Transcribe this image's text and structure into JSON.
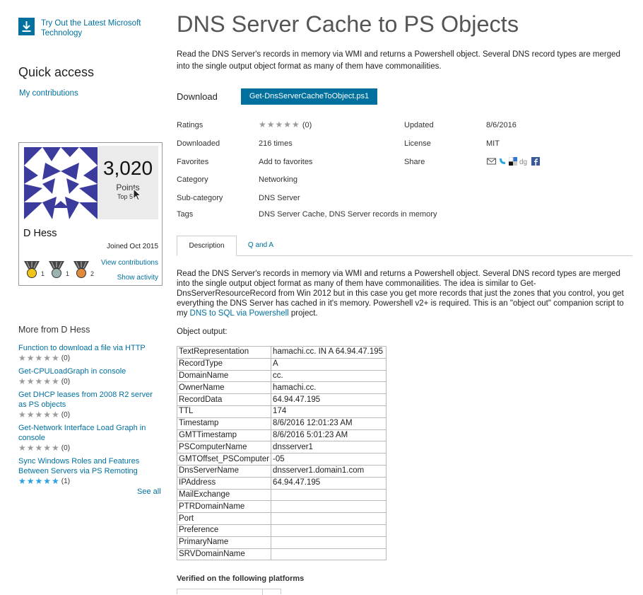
{
  "sidebar": {
    "promo_text": "Try Out the Latest Microsoft Technology",
    "quick_access_title": "Quick access",
    "my_contributions": "My contributions",
    "profile": {
      "points": "3,020",
      "points_label": "Points",
      "rank": "Top 5%",
      "name": "D Hess",
      "joined": "Joined Oct 2015",
      "view_contributions": "View contributions",
      "show_activity": "Show activity",
      "medals": [
        {
          "color": "#f0c419",
          "count": "1"
        },
        {
          "color": "#9bb3b0",
          "count": "1"
        },
        {
          "color": "#e08a3c",
          "count": "2"
        }
      ]
    },
    "more_title": "More from D Hess",
    "more_items": [
      {
        "title": "Function to download a file via HTTP",
        "stars": "★★★★★",
        "rating": "(0)",
        "star_color": "grey"
      },
      {
        "title": "Get-CPULoadGraph in console",
        "stars": "★★★★★",
        "rating": "(0)",
        "star_color": "grey"
      },
      {
        "title": "Get DHCP leases from 2008 R2 server as PS objects",
        "stars": "★★★★★",
        "rating": "(0)",
        "star_color": "grey"
      },
      {
        "title": "Get-Network Interface Load Graph in console",
        "stars": "★★★★★",
        "rating": "(0)",
        "star_color": "grey"
      },
      {
        "title": "Sync Windows Roles and Features Between Servers via PS Remoting",
        "stars": "★★★★★",
        "rating": "(1)",
        "star_color": "blue"
      }
    ],
    "see_all": "See all"
  },
  "main": {
    "title": "DNS Server Cache to PS Objects",
    "summary": "Read the DNS Server's records in memory via WMI and returns a Powershell object. Several DNS record types are merged into the single output object format as many of them have commonailities.",
    "download_label": "Download",
    "download_file": "Get-DnsServerCacheToObject.ps1",
    "meta": {
      "ratings_label": "Ratings",
      "ratings_stars": "★★★★★",
      "ratings_count": "(0)",
      "updated_label": "Updated",
      "updated_value": "8/6/2016",
      "downloaded_label": "Downloaded",
      "downloaded_value": "216 times",
      "license_label": "License",
      "license_value": "MIT",
      "favorites_label": "Favorites",
      "favorites_value": "Add to favorites",
      "share_label": "Share",
      "category_label": "Category",
      "category_value": "Networking",
      "subcategory_label": "Sub-category",
      "subcategory_value": "DNS Server",
      "tags_label": "Tags",
      "tags_value": "DNS Server Cache, DNS Server records in memory"
    },
    "tabs": {
      "description": "Description",
      "qa": "Q and A"
    },
    "description_before_link": "Read the DNS Server's records in memory via WMI and returns a Powershell object. Several DNS record types are merged into the single output object format as many of them have commonailities.  The idea is similar to Get-DnsServerResourceRecord from Win 2012 but in this case you get more records that just the zones that you control, you get everything the DNS Server has cached in it's memory.  Powershell v2+ is required.  This is an \"object out\" companion script to my ",
    "description_link": "DNS to SQL via Powershell",
    "description_after_link": " project.",
    "object_output_label": "Object output:",
    "output_rows": [
      [
        "TextRepresentation",
        "hamachi.cc. IN A 64.94.47.195"
      ],
      [
        "RecordType",
        "A"
      ],
      [
        "DomainName",
        "cc."
      ],
      [
        "OwnerName",
        "hamachi.cc."
      ],
      [
        "RecordData",
        "64.94.47.195"
      ],
      [
        "TTL",
        "174"
      ],
      [
        "Timestamp",
        "8/6/2016 12:01:23 AM"
      ],
      [
        "GMTTimestamp",
        "8/6/2016 5:01:23 AM"
      ],
      [
        "PSComputerName",
        "dnsserver1"
      ],
      [
        "GMTOffset_PSComputer",
        "-05"
      ],
      [
        "DnsServerName",
        "dnsserver1.domain1.com"
      ],
      [
        "IPAddress",
        "64.94.47.195"
      ],
      [
        "MailExchange",
        ""
      ],
      [
        "PTRDomainName",
        ""
      ],
      [
        "Port",
        ""
      ],
      [
        "Preference",
        ""
      ],
      [
        "PrimaryName",
        ""
      ],
      [
        "SRVDomainName",
        ""
      ]
    ],
    "verified_label": "Verified on the following platforms"
  }
}
